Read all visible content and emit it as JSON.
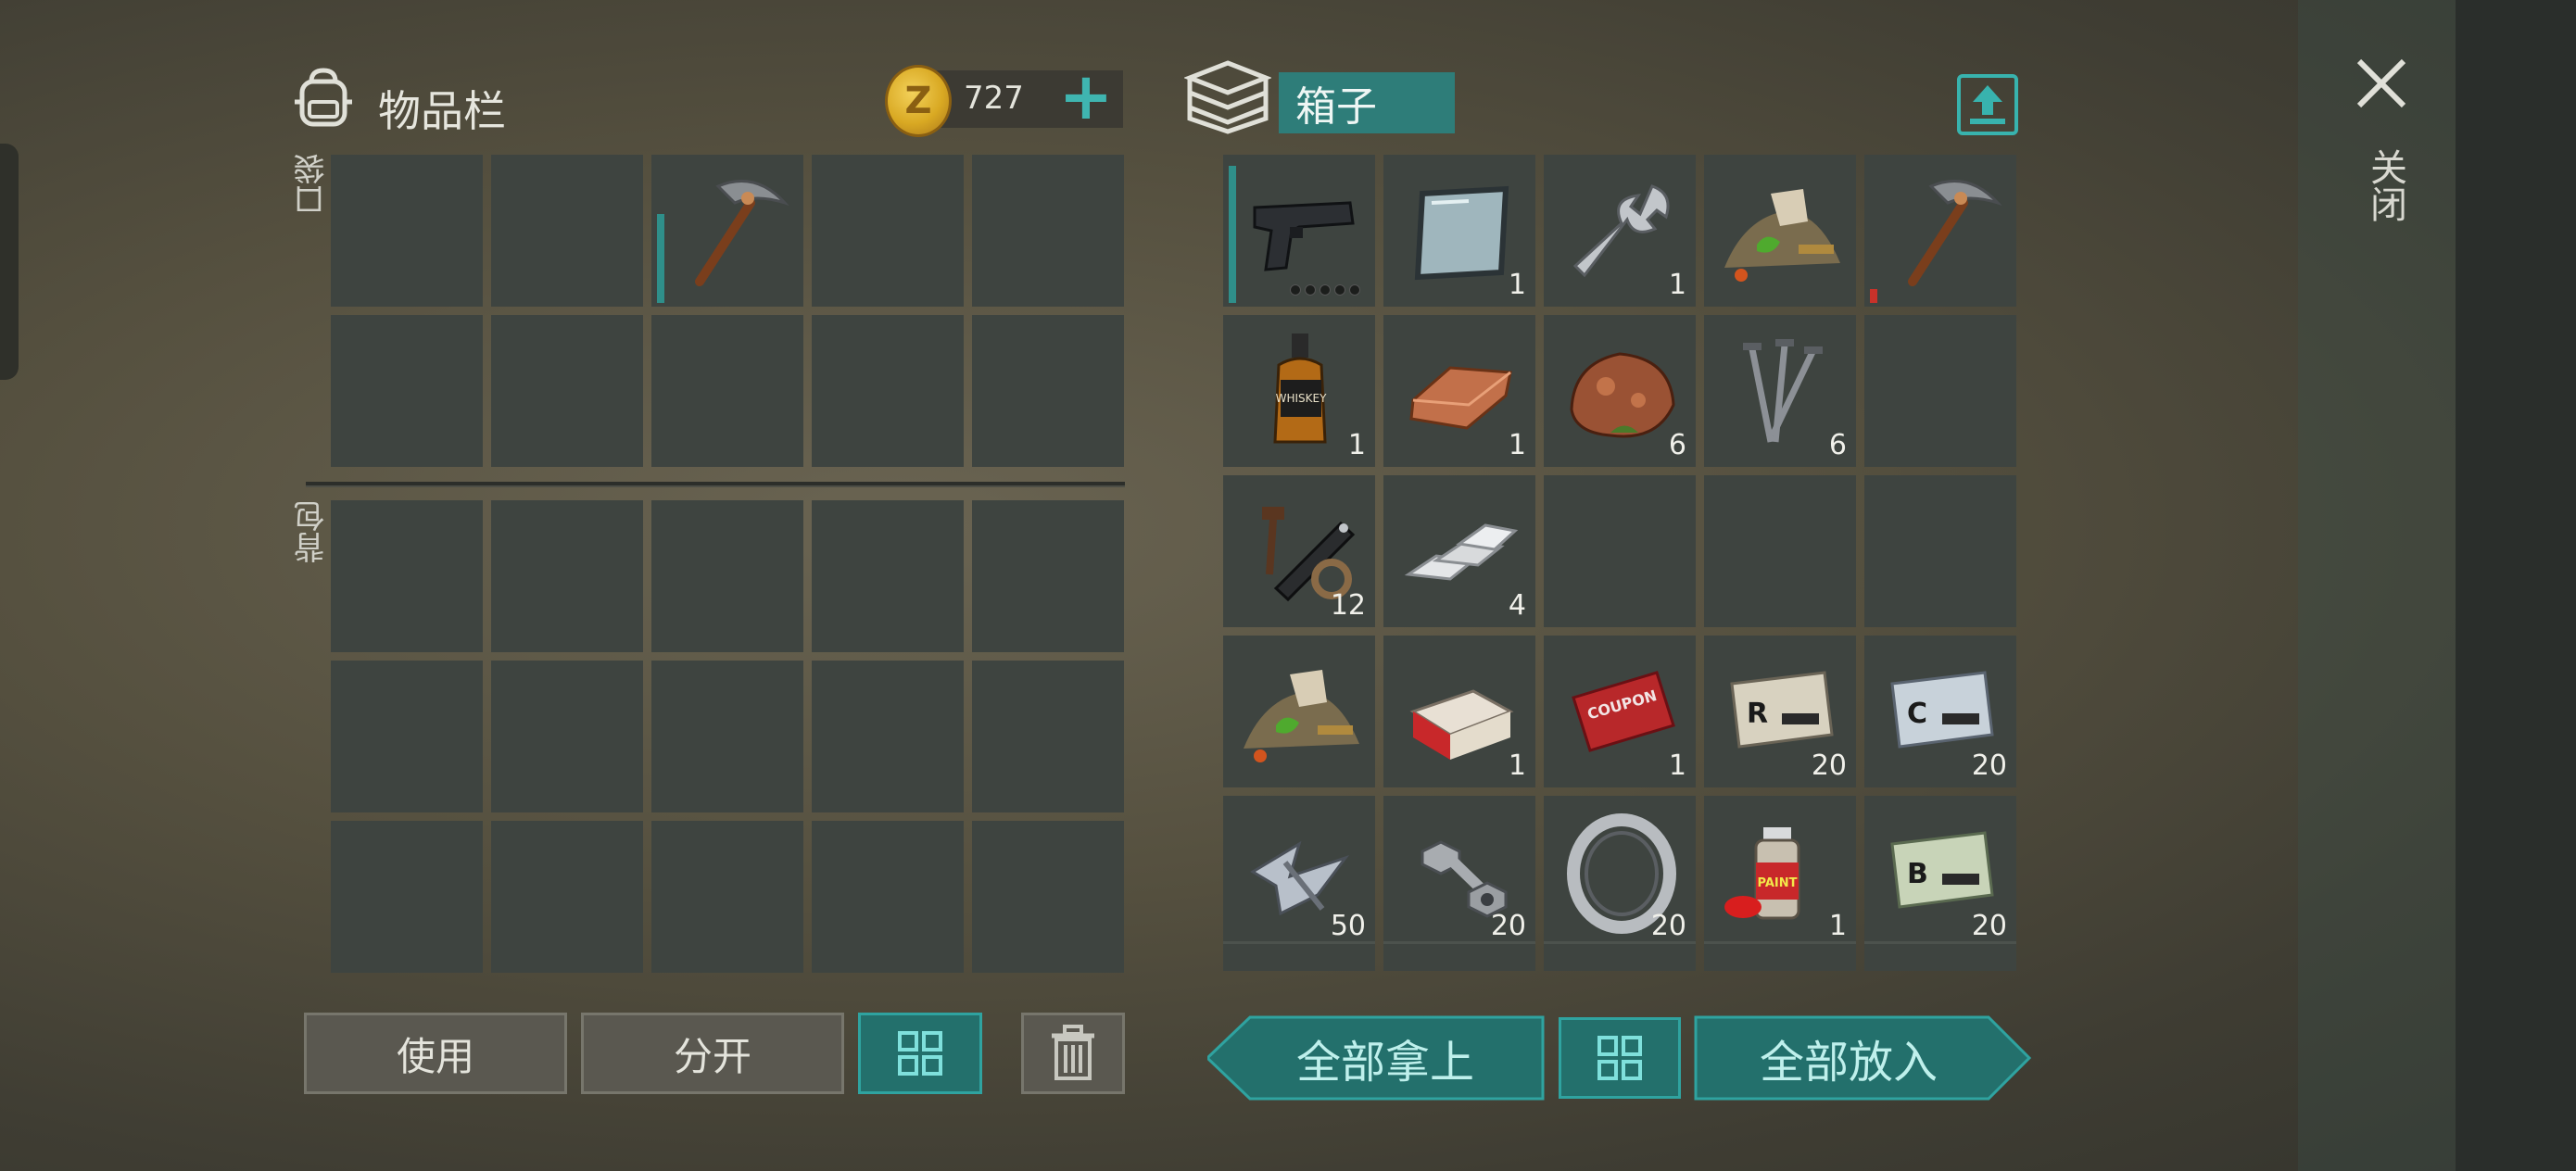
{
  "inventory": {
    "title": "物品栏",
    "coins": "727",
    "pocket_label": "口袋",
    "backpack_label": "背包",
    "pocket_cells": [
      {
        "icon": "",
        "qty": ""
      },
      {
        "icon": "",
        "qty": ""
      },
      {
        "icon": "pickaxe-icon",
        "qty": "",
        "durability": 0.65,
        "durability_color": "#2f8f8a"
      },
      {
        "icon": "",
        "qty": ""
      },
      {
        "icon": "",
        "qty": ""
      },
      {
        "icon": "",
        "qty": ""
      },
      {
        "icon": "",
        "qty": ""
      },
      {
        "icon": "",
        "qty": ""
      },
      {
        "icon": "",
        "qty": ""
      },
      {
        "icon": "",
        "qty": ""
      }
    ],
    "backpack_rows": 3
  },
  "buttons": {
    "use": "使用",
    "split": "分开",
    "take_all": "全部拿上",
    "put_all": "全部放入"
  },
  "container": {
    "title": "箱子",
    "cells": [
      {
        "icon": "pistol-icon",
        "qty": "",
        "durability": 1.0,
        "durability_color": "#2f8f8a",
        "ammo_dots": 5
      },
      {
        "icon": "glass-pane-icon",
        "qty": "1"
      },
      {
        "icon": "wrench-icon",
        "qty": "1"
      },
      {
        "icon": "ore-pile-icon",
        "qty": ""
      },
      {
        "icon": "pickaxe-icon",
        "qty": "",
        "durability": 0.1,
        "durability_color": "#c8322a"
      },
      {
        "icon": "whiskey-bottle-icon",
        "qty": "1"
      },
      {
        "icon": "copper-ingot-icon",
        "qty": "1"
      },
      {
        "icon": "copper-ore-icon",
        "qty": "6"
      },
      {
        "icon": "nails-icon",
        "qty": "6"
      },
      {
        "icon": "",
        "qty": ""
      },
      {
        "icon": "scope-parts-icon",
        "qty": "12"
      },
      {
        "icon": "silver-ingots-icon",
        "qty": "4"
      },
      {
        "icon": "",
        "qty": ""
      },
      {
        "icon": "",
        "qty": ""
      },
      {
        "icon": "",
        "qty": ""
      },
      {
        "icon": "ore-pile-icon",
        "qty": ""
      },
      {
        "icon": "cigarette-pack-icon",
        "qty": "1"
      },
      {
        "icon": "coupon-icon",
        "qty": "1"
      },
      {
        "icon": "army-card-r-icon",
        "qty": "20"
      },
      {
        "icon": "army-card-c-icon",
        "qty": "20"
      },
      {
        "icon": "metal-scrap-icon",
        "qty": "50"
      },
      {
        "icon": "bolt-nut-icon",
        "qty": "20"
      },
      {
        "icon": "bearing-ring-icon",
        "qty": "20"
      },
      {
        "icon": "spray-paint-icon",
        "qty": "1"
      },
      {
        "icon": "army-card-b-icon",
        "qty": "20"
      }
    ]
  },
  "close_label": "关闭"
}
